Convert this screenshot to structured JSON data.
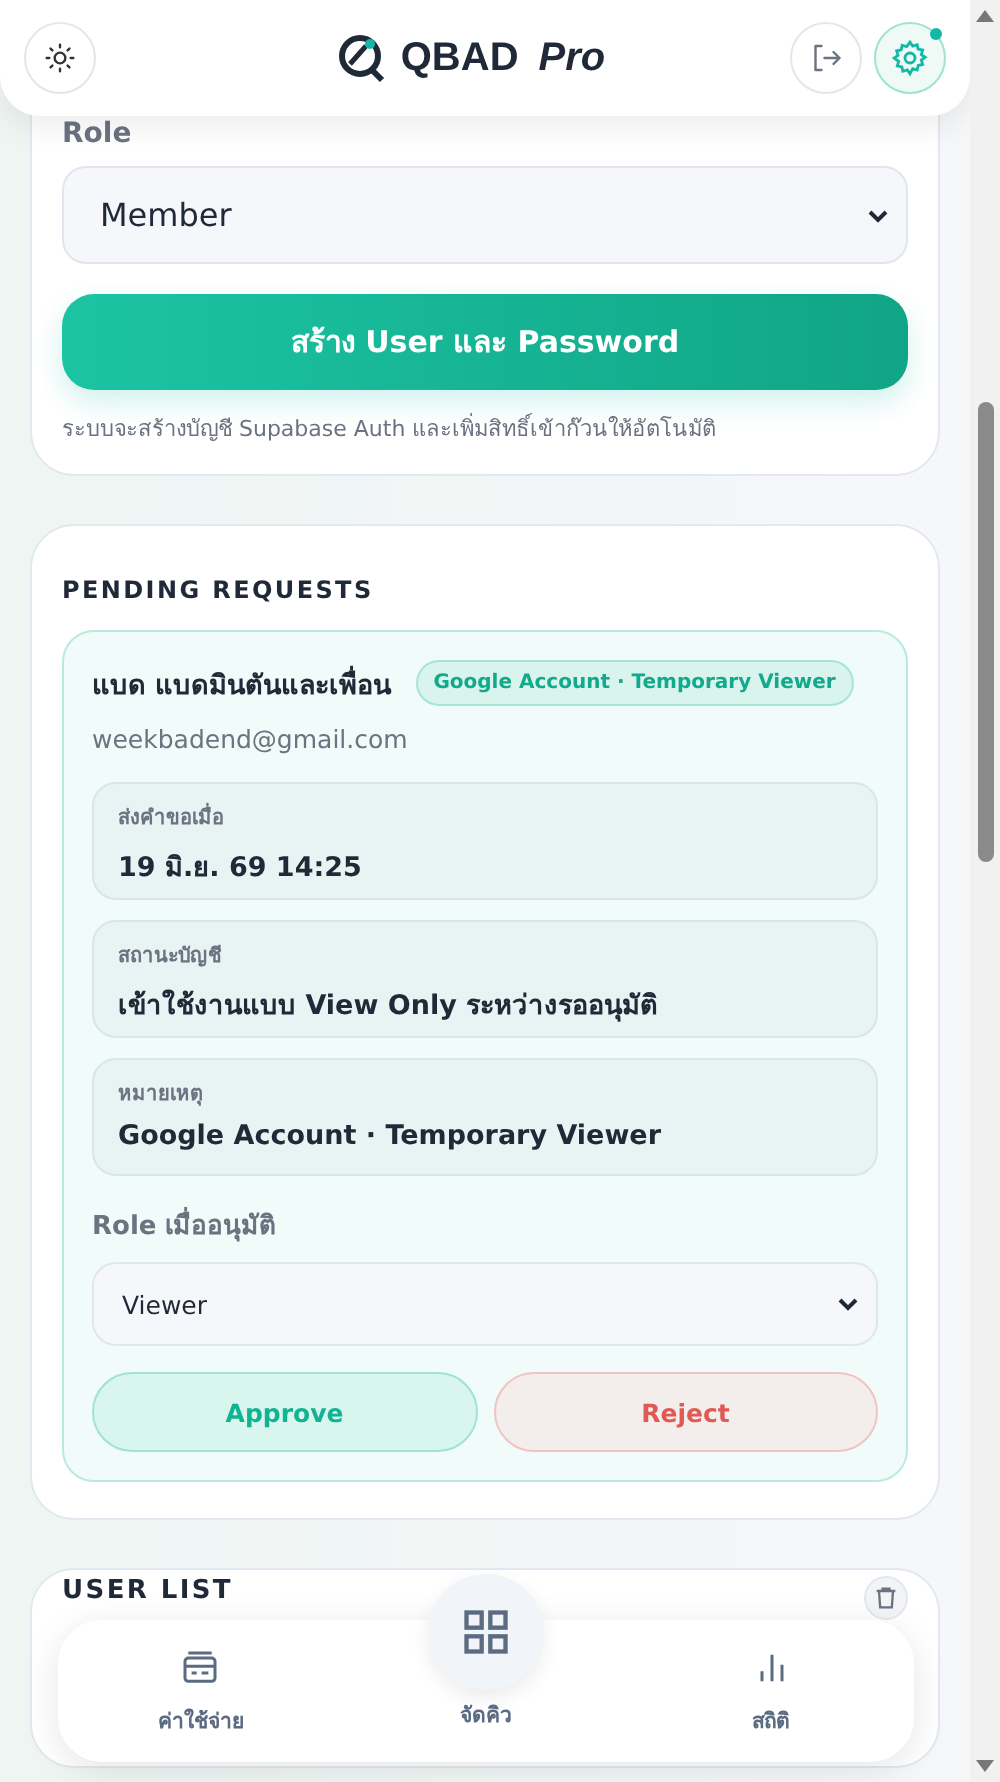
{
  "header": {
    "brand": "QBAD",
    "brand_suffix": "Pro",
    "settings_notification": true
  },
  "create_user": {
    "role_label": "Role",
    "role_value": "Member",
    "submit": "สร้าง User และ Password",
    "note": "ระบบจะสร้างบัญชี Supabase Auth และเพิ่มสิทธิ์เข้าก๊วนให้อัตโนมัติ"
  },
  "pending_requests": {
    "title": "PENDING REQUESTS",
    "requests": [
      {
        "name": "แบด แบดมินตันและเพื่อน",
        "badge": "Google Account · Temporary Viewer",
        "email": "weekbadend@gmail.com",
        "fields": [
          {
            "label": "ส่งคำขอเมื่อ",
            "value": "19 มิ.ย. 69 14:25"
          },
          {
            "label": "สถานะบัญชี",
            "value": "เข้าใช้งานแบบ View Only ระหว่างรออนุมัติ"
          },
          {
            "label": "หมายเหตุ",
            "value": "Google Account · Temporary Viewer"
          }
        ],
        "role_label": "Role เมื่ออนุมัติ",
        "role_value": "Viewer",
        "approve": "Approve",
        "reject": "Reject"
      }
    ]
  },
  "user_list": {
    "title": "USER LIST"
  },
  "bottom_nav": [
    {
      "kind": "card",
      "label": "ค่าใช้จ่าย"
    },
    {
      "kind": "grid",
      "label": "จัดคิว",
      "center": true
    },
    {
      "kind": "bars",
      "label": "สถิติ"
    }
  ]
}
